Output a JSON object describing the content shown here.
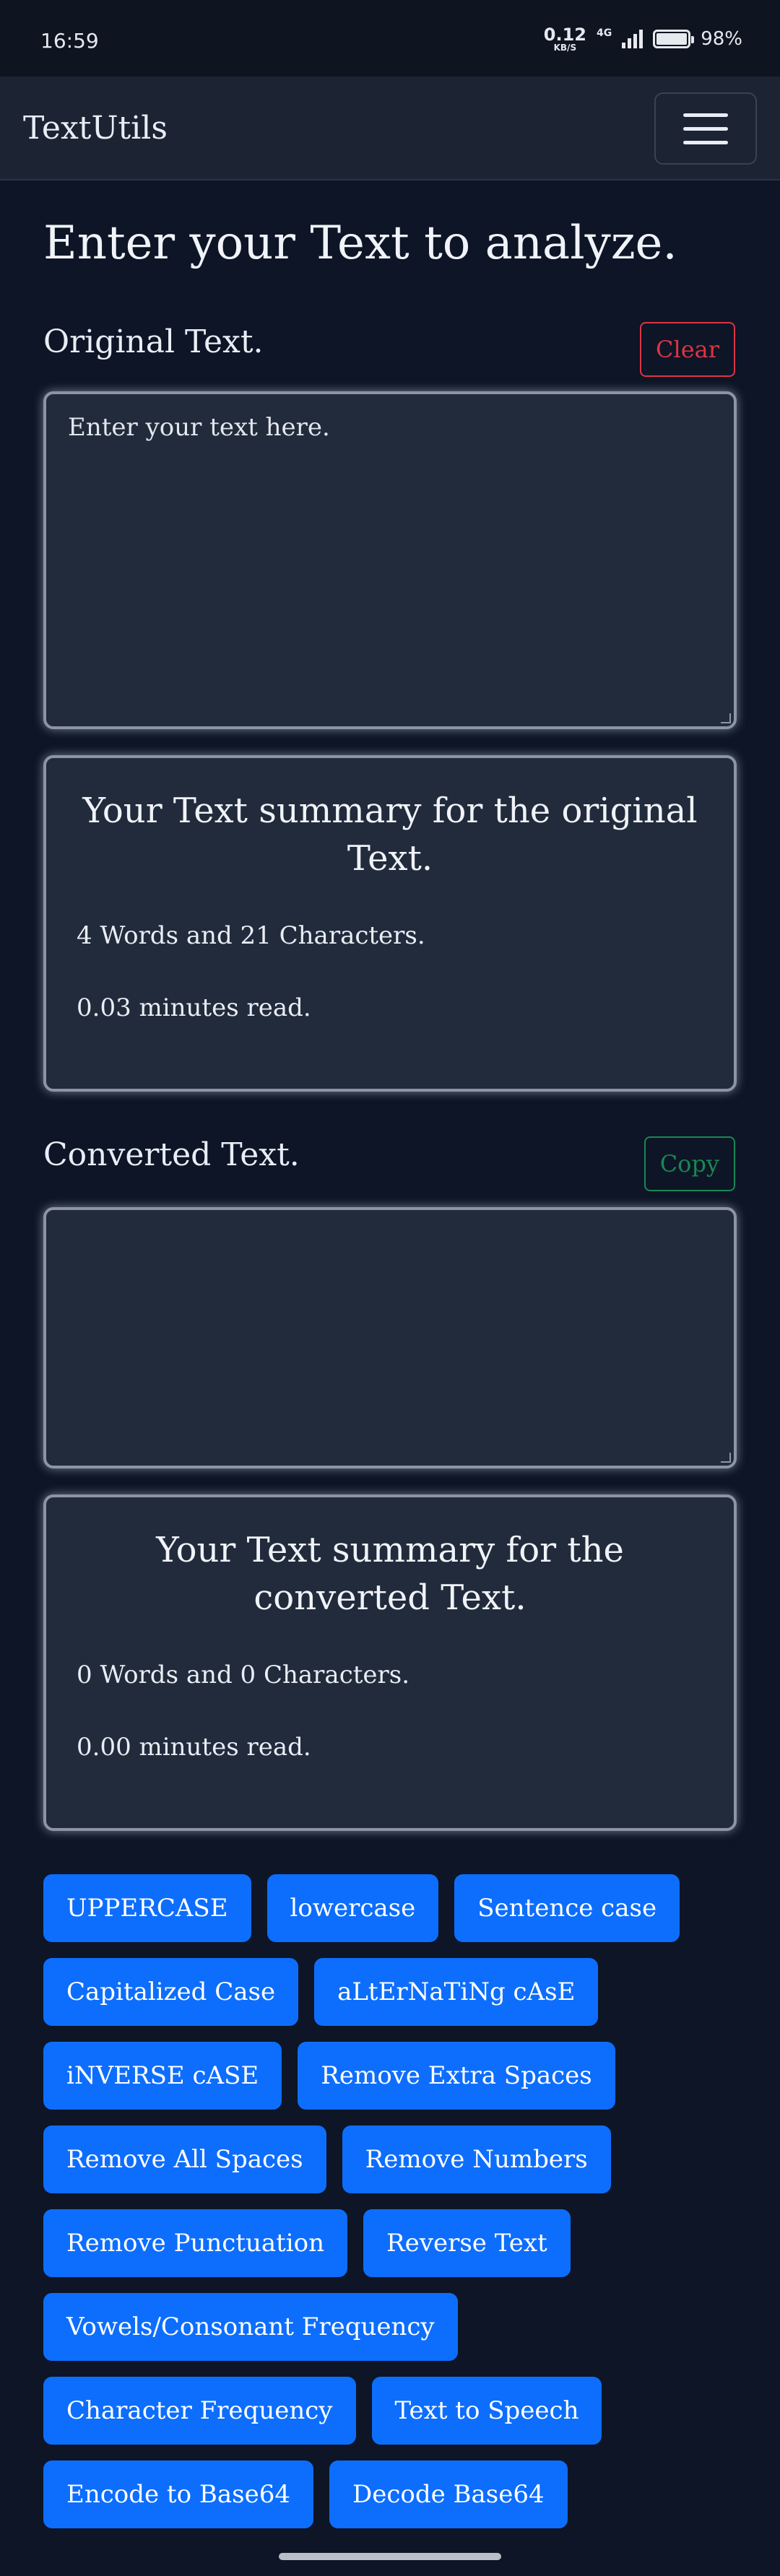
{
  "status_bar": {
    "time": "16:59",
    "net_speed": "0.12",
    "net_unit": "KB/S",
    "network_type": "4G",
    "battery": "98%"
  },
  "navbar": {
    "brand": "TextUtils",
    "menu_icon": "hamburger-icon"
  },
  "main": {
    "heading": "Enter your Text to analyze.",
    "original": {
      "label": "Original Text.",
      "clear_label": "Clear",
      "placeholder": "Enter your text here.",
      "value": ""
    },
    "original_summary": {
      "title": "Your Text summary for the original Text.",
      "words_chars": "4 Words and 21 Characters.",
      "read_time": "0.03 minutes read."
    },
    "converted": {
      "label": "Converted Text.",
      "copy_label": "Copy",
      "value": ""
    },
    "converted_summary": {
      "title": "Your Text summary for the converted Text.",
      "words_chars": "0 Words and 0 Characters.",
      "read_time": "0.00 minutes read."
    }
  },
  "actions": [
    [
      "UPPERCASE",
      "lowercase",
      "Sentence case"
    ],
    [
      "Capitalized Case",
      "aLtErNaTiNg cAsE"
    ],
    [
      "iNVERSE cASE",
      "Remove Extra Spaces"
    ],
    [
      "Remove All Spaces",
      "Remove Numbers"
    ],
    [
      "Remove Punctuation",
      "Reverse Text"
    ],
    [
      "Vowels/Consonant Frequency"
    ],
    [
      "Character Frequency",
      "Text to Speech"
    ],
    [
      "Encode to Base64",
      "Decode Base64"
    ]
  ],
  "colors": {
    "background": "#0d1526",
    "primary": "#0d6efd",
    "danger": "#dc3545",
    "success": "#198754"
  }
}
